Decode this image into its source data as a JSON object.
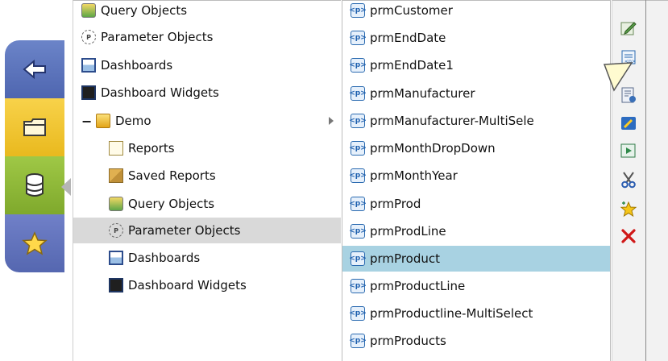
{
  "nav": {
    "items": [
      {
        "name": "recent",
        "icon": "back-arrow-icon"
      },
      {
        "name": "folders",
        "icon": "folder-icon"
      },
      {
        "name": "database",
        "icon": "database-icon"
      },
      {
        "name": "favorites",
        "icon": "star-icon"
      }
    ]
  },
  "tree": {
    "items": [
      {
        "label": "Query Objects",
        "icon": "query-objects-icon"
      },
      {
        "label": "Parameter Objects",
        "icon": "parameter-objects-icon"
      },
      {
        "label": "Dashboards",
        "icon": "dashboards-icon"
      },
      {
        "label": "Dashboard Widgets",
        "icon": "dashboard-widgets-icon"
      },
      {
        "label": "Demo",
        "icon": "folder-icon",
        "expander": "−"
      },
      {
        "label": "Reports",
        "icon": "reports-icon"
      },
      {
        "label": "Saved Reports",
        "icon": "saved-reports-icon"
      },
      {
        "label": "Query Objects",
        "icon": "query-objects-icon"
      },
      {
        "label": "Parameter Objects",
        "icon": "parameter-objects-icon",
        "selected": true
      },
      {
        "label": "Dashboards",
        "icon": "dashboards-icon"
      },
      {
        "label": "Dashboard Widgets",
        "icon": "dashboard-widgets-icon"
      }
    ]
  },
  "list": {
    "icon_text": "<p>",
    "items": [
      "prmCustomer",
      "prmEndDate",
      "prmEndDate1",
      "prmManufacturer",
      "prmManufacturer-MultiSele",
      "prmMonthDropDown",
      "prmMonthYear",
      "prmProd",
      "prmProdLine",
      "prmProduct",
      "prmProductLine",
      "prmProductline-MultiSelect",
      "prmProducts"
    ],
    "selected_item": "prmProduct"
  },
  "toolbar": {
    "tools": [
      {
        "name": "edit-tool",
        "icon": "pencil-edit-icon",
        "color": "#4a8a3a"
      },
      {
        "name": "new-parameter-tool",
        "icon": "new-parameter-icon",
        "color": "#2a6ab0"
      },
      {
        "name": "properties-tool",
        "icon": "properties-icon",
        "color": "#3a70b8"
      },
      {
        "name": "wizard-tool",
        "icon": "wizard-icon",
        "color": "#2d6cc0"
      },
      {
        "name": "run-tool",
        "icon": "run-icon",
        "color": "#2f8a4a"
      },
      {
        "name": "cut-tool",
        "icon": "scissors-icon",
        "color": "#555555"
      },
      {
        "name": "add-favorite-tool",
        "icon": "star-plus-icon",
        "color": "#e0b000"
      },
      {
        "name": "delete-tool",
        "icon": "delete-x-icon",
        "color": "#d01818"
      }
    ]
  },
  "colors": {
    "nav_blue": "#5a71bb",
    "nav_yellow": "#f0c533",
    "nav_green": "#8cb538",
    "tree_selection": "#d9d9d9",
    "list_selection": "#a8d2e2"
  }
}
